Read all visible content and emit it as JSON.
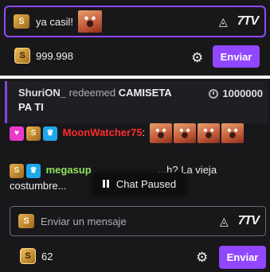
{
  "top_panel": {
    "input_text": "ya casil!",
    "points_value": "999.998",
    "send_label": "Enviar"
  },
  "redemption": {
    "user": "ShuriON_",
    "action": "redeemed",
    "reward_line1": "CAMISETA",
    "reward_line2": "PA TI",
    "cost": "1000000"
  },
  "messages": [
    {
      "username": "MoonWatcher75",
      "separator": ":",
      "text": ""
    },
    {
      "username": "megasup",
      "text": "...h? La vieja",
      "text_line2": "costumbre..."
    }
  ],
  "chat_paused": {
    "label": "Chat Paused"
  },
  "bottom_panel": {
    "placeholder": "Enviar un mensaje",
    "points_value": "62",
    "send_label": "Enviar"
  },
  "colors": {
    "accent": "#9147ff",
    "moon_user": "#ff2b2b",
    "mega_user": "#91e25c",
    "background": "#18181b"
  }
}
